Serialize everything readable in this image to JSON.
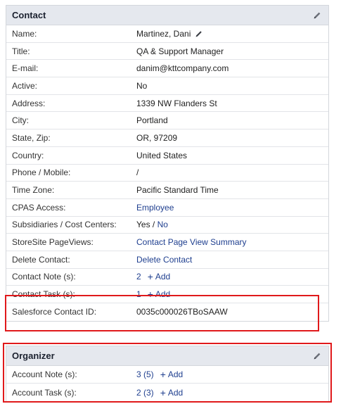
{
  "contact": {
    "title": "Contact",
    "name_label": "Name:",
    "name_value": "Martinez, Dani",
    "rows": [
      {
        "label": "Title:",
        "value": "QA & Support Manager"
      },
      {
        "label": "E-mail:",
        "value": "danim@kttcompany.com"
      },
      {
        "label": "Active:",
        "value": "No"
      },
      {
        "label": "Address:",
        "value": "1339 NW Flanders St"
      },
      {
        "label": "City:",
        "value": "Portland"
      },
      {
        "label": "State, Zip:",
        "value": "OR, 97209"
      },
      {
        "label": "Country:",
        "value": "United States"
      },
      {
        "label": "Phone / Mobile:",
        "value": "/"
      },
      {
        "label": "Time Zone:",
        "value": "Pacific Standard Time"
      }
    ],
    "cpas_label": "CPAS Access:",
    "cpas_value": "Employee",
    "subsidiaries_label": "Subsidiaries / Cost Centers:",
    "subsidiaries_yes": "Yes",
    "subsidiaries_sep": " / ",
    "subsidiaries_no": "No",
    "storesite_label": "StoreSite PageViews:",
    "storesite_value": "Contact Page View Summary",
    "delete_label": "Delete Contact:",
    "delete_value": "Delete Contact",
    "note_label": "Contact Note (s):",
    "note_count": "2",
    "task_label": "Contact Task (s):",
    "task_count": "1",
    "add_label": "Add",
    "salesforce_label": "Salesforce Contact ID:",
    "salesforce_value": "0035c000026TBoSAAW"
  },
  "organizer": {
    "title": "Organizer",
    "account_note_label": "Account Note (s):",
    "account_note_count": "3 (5)",
    "account_task_label": "Account Task (s):",
    "account_task_count": "2 (3)",
    "add_label": "Add"
  },
  "icons": {
    "edit": "pencil-icon",
    "add": "plus-icon"
  },
  "colors": {
    "header_bg": "#e5e8ee",
    "link": "#1f3f8f",
    "highlight": "#e0191b"
  }
}
